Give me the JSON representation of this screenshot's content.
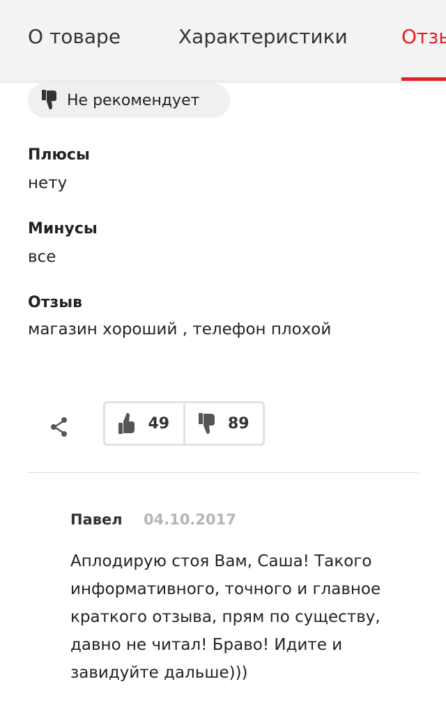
{
  "tabs": [
    {
      "label": "О товаре"
    },
    {
      "label": "Характеристики"
    },
    {
      "label": "Отзывы",
      "active": true
    }
  ],
  "accent_color": "#e31e24",
  "review": {
    "recommendation": "Не рекомендует",
    "pros_title": "Плюсы",
    "pros_text": "нету",
    "cons_title": "Минусы",
    "cons_text": "все",
    "review_title": "Отзыв",
    "review_text": "магазин хороший , телефон плохой",
    "likes": "49",
    "dislikes": "89"
  },
  "icons": {
    "share": "share-icon",
    "thumbs_up": "thumbs-up-icon",
    "thumbs_down": "thumbs-down-icon"
  },
  "comment": {
    "author": "Павел",
    "date": "04.10.2017",
    "text": "Аплодирую стоя Вам, Саша! Такого информативного, точного и главное краткого отзыва, прям по существу, давно не читал! Браво! Идите и завидуйте дальше)))"
  }
}
